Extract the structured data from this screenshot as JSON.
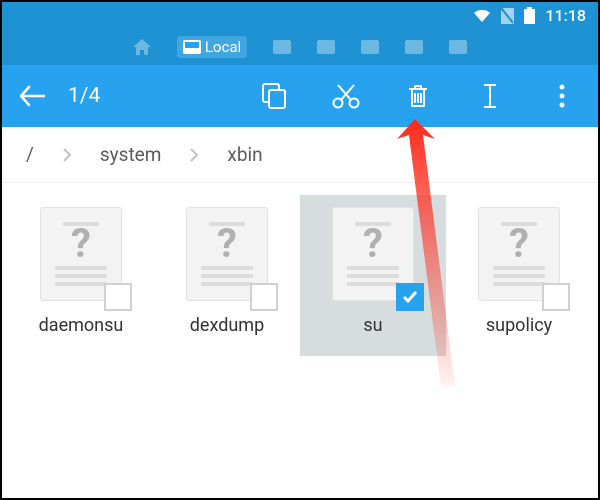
{
  "status": {
    "time": "11:18"
  },
  "tabs": {
    "local_label": "Local"
  },
  "actionbar": {
    "counter": "1/4"
  },
  "breadcrumb": {
    "root": "/",
    "seg1": "system",
    "seg2": "xbin"
  },
  "files": {
    "items": [
      {
        "name": "daemonsu",
        "selected": false
      },
      {
        "name": "dexdump",
        "selected": false
      },
      {
        "name": "su",
        "selected": true
      },
      {
        "name": "supolicy",
        "selected": false
      }
    ]
  }
}
